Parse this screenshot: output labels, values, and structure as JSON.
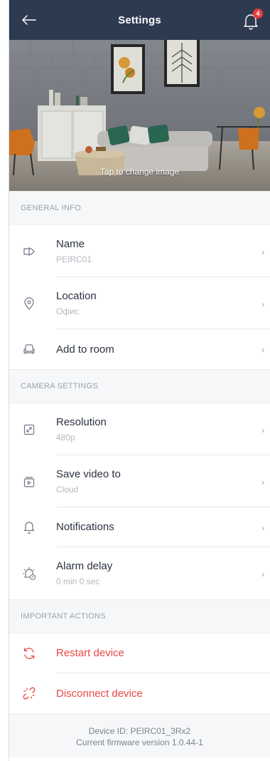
{
  "header": {
    "title": "Settings",
    "notification_count": "4"
  },
  "cover": {
    "caption": "Tap to change image"
  },
  "general": {
    "section_title": "GENERAL INFO",
    "name": {
      "label": "Name",
      "value": "PEIRC01"
    },
    "location": {
      "label": "Location",
      "value": "Офис"
    },
    "room": {
      "label": "Add to room"
    }
  },
  "camera": {
    "section_title": "CAMERA SETTINGS",
    "resolution": {
      "label": "Resolution",
      "value": "480p"
    },
    "save_video": {
      "label": "Save video to",
      "value": "Cloud"
    },
    "notifications": {
      "label": "Notifications"
    },
    "alarm_delay": {
      "label": "Alarm delay",
      "value": "0 min 0 sec"
    }
  },
  "actions": {
    "section_title": "IMPORTANT ACTIONS",
    "restart": {
      "label": "Restart device"
    },
    "disconnect": {
      "label": "Disconnect device"
    }
  },
  "footer": {
    "device_id": "Device ID: PEIRC01_3Rx2",
    "firmware": "Current firmware version 1.0.44-1"
  },
  "colors": {
    "header": "#2e3a50",
    "danger": "#e84848",
    "badge": "#e83d3d",
    "muted": "#b3b7bf"
  }
}
